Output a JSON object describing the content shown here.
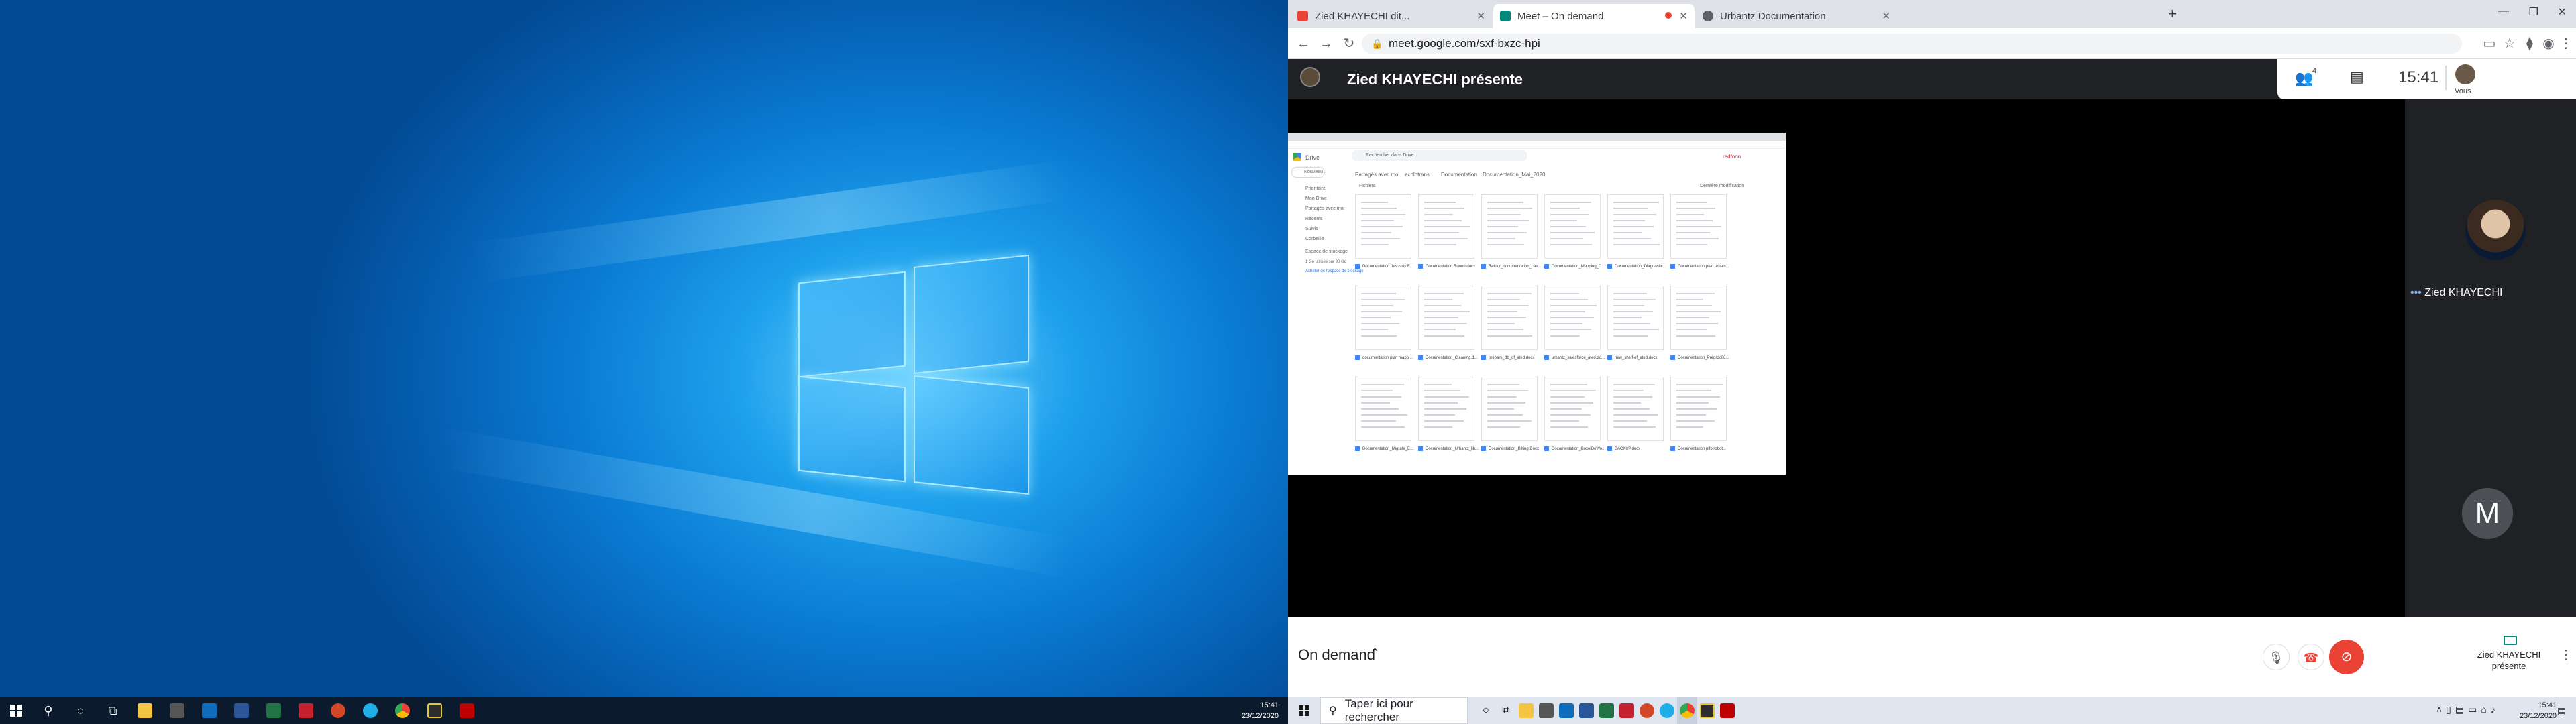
{
  "left_taskbar": {
    "time": "15:41",
    "date": "23/12/2020"
  },
  "browser": {
    "tabs": [
      {
        "label": "Zied KHAYECHI dit...",
        "icon": "gmail-icon",
        "color": "#ea4335"
      },
      {
        "label": "Meet – On demand",
        "icon": "meet-icon",
        "color": "#00897b"
      },
      {
        "label": "Urbantz Documentation",
        "icon": "globe-icon",
        "color": "#5f6368"
      }
    ],
    "url": "meet.google.com/sxf-bxzc-hpi"
  },
  "meet": {
    "presenter_title": "Zied KHAYECHI présente",
    "participants_count": "4",
    "time": "15:41",
    "self_label": "Vous",
    "participant_name": "Zied KHAYECHI",
    "participant_initial": "M",
    "meeting_title": "On demand",
    "present_label_line1": "Zied KHAYECHI",
    "present_label_line2": "présente",
    "accent": "#ea4335"
  },
  "drive": {
    "search_placeholder": "Rechercher dans Drive",
    "logo_text": "Drive",
    "new_button": "Nouveau",
    "brand": "redfoon",
    "nav": [
      "Prioritaire",
      "Mon Drive",
      "Partagés avec moi",
      "Récents",
      "Suivis",
      "Corbeille"
    ],
    "storage_label": "Espace de stockage",
    "storage_used": "1 Go utilisés sur 30 Go",
    "storage_link": "Acheter de l'espace de stockage",
    "breadcrumb": [
      "Partagés avec moi",
      "ecolotrans",
      "Documentation",
      "Documentation_Mai_2020"
    ],
    "section": "Fichiers",
    "sort": "Dernière modification",
    "files": [
      "Documentation des colis E...",
      "Documentation Round.docx",
      "Retour_documentation_cas...",
      "Documentation_Mapping_C...",
      "Documentation_Diagnostic...",
      "Documentation plan urbain...",
      "documentation plan mappi...",
      "Documentation_Cleaning.d...",
      "prepare_db_of_ated.docx",
      "urbantz_salesforce_ated.do...",
      "new_shelf-of_ated.docx",
      "Documentation_Preproc08...",
      "Documentation_Migrate_E...",
      "Documentation_Urbantz_lib...",
      "Documentation_Billing.Docx",
      "Documentation_BoxelDeWo...",
      "BACKUP.docx",
      "Documentation plfo robot..."
    ]
  },
  "right_taskbar": {
    "search_placeholder": "Taper ici pour rechercher",
    "time": "15:41",
    "date": "23/12/2020"
  }
}
